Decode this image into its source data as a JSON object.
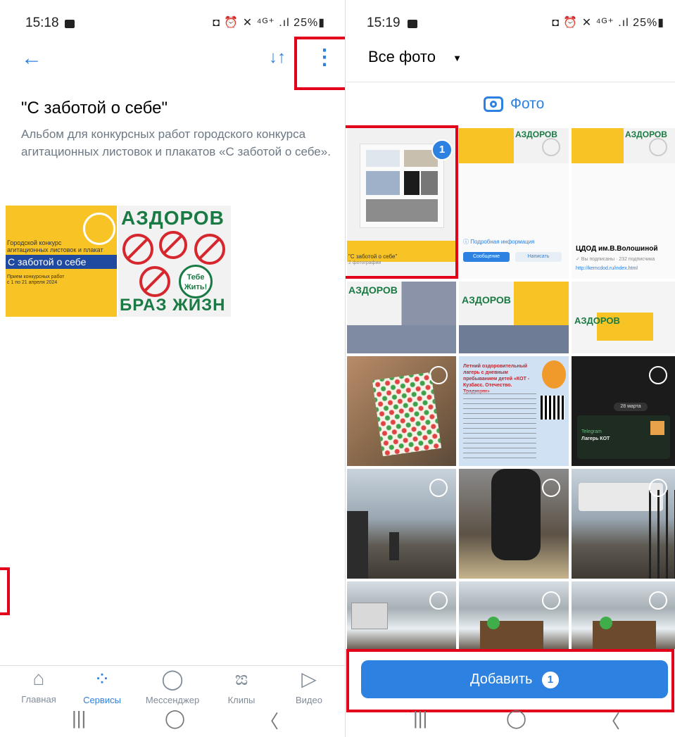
{
  "left": {
    "status": {
      "time": "15:18",
      "right": "◘ ⏰ ✕ ⁴ᴳ⁺ .ıl 25%▮"
    },
    "header": {
      "sort_icon": "↓↑",
      "more_icon": "⋮"
    },
    "album": {
      "title": "\"С заботой о себе\"",
      "description": "Альбом для конкурсных работ городского конкурса агитационных листовок и плакатов «С заботой о себе»."
    },
    "photo1": {
      "line1": "Городской конкурс",
      "line2": "агитационных листовок и плакат",
      "banner": "С заботой о себе",
      "line3": "Прием конкурсных работ",
      "line4": "с 1 по 21 апреля 2024"
    },
    "photo2": {
      "top": "АЗДОРОВ",
      "badge1": "Тебе",
      "badge2": "Жить!",
      "bottom": "БРАЗ ЖИЗН"
    },
    "tabs": [
      {
        "label": "Главная",
        "icon": "⌂"
      },
      {
        "label": "Сервисы",
        "icon": "⁘"
      },
      {
        "label": "Мессенджер",
        "icon": "◯"
      },
      {
        "label": "Клипы",
        "icon": "ಙ"
      },
      {
        "label": "Видео",
        "icon": "▷"
      }
    ],
    "nav": {
      "recent": "|||",
      "home": "◯",
      "back": "〈"
    }
  },
  "right": {
    "status": {
      "time": "15:19",
      "right": "◘ ⏰ ✕ ⁴ᴳ⁺ .ıl 25%▮"
    },
    "dropdown": {
      "label": "Все фото",
      "arrow": "▼"
    },
    "source": {
      "label": "Фото",
      "icon": "camera-icon"
    },
    "selected_badge": "1",
    "tile_texts": {
      "album_label": "\"С заботой о себе\"",
      "album_sub": "2 фотографии",
      "ad_title": "ЦДОД им.В.Волошиной",
      "ad_subs": "✓ Вы подписаны · 232 подписчика",
      "ad_link": "http://kemcdod.ru/index.html",
      "ad_info": "ⓘ Подробная информация",
      "btn_msg": "Сообщение",
      "btn_write": "Написать",
      "camp_title": "Летний оздоровительный лагерь с дневным пребыванием детей «КОТ - Кузбасс. Отечество. Традиции»",
      "tg_title": "Telegram",
      "tg_text": "Лагерь КОТ",
      "tg_date": "28 марта"
    },
    "add_button": {
      "label": "Добавить",
      "count": "1"
    },
    "nav": {
      "recent": "|||",
      "home": "◯",
      "back": "〈"
    }
  },
  "colors": {
    "accent": "#2d81e0",
    "highlight": "#e3001b",
    "text": "#000000",
    "secondary": "#6d7885"
  }
}
